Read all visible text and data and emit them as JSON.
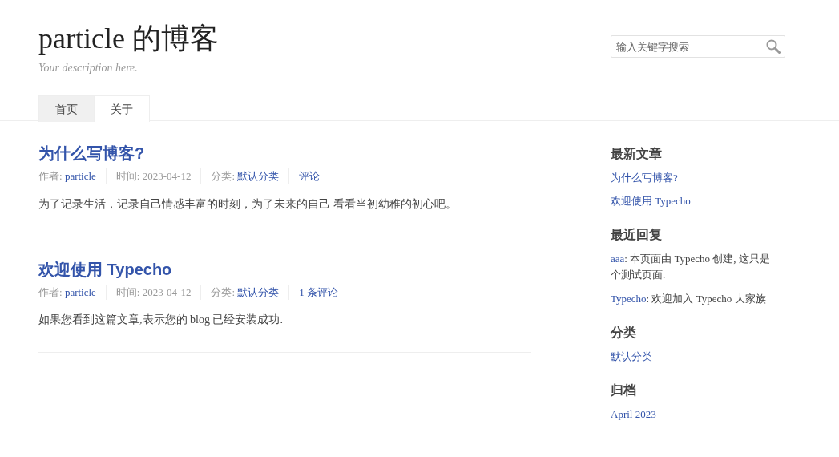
{
  "site": {
    "title": "particle 的博客",
    "description": "Your description here."
  },
  "search": {
    "placeholder": "输入关键字搜索"
  },
  "nav": [
    {
      "label": "首页",
      "selected": true
    },
    {
      "label": "关于",
      "selected": false
    }
  ],
  "posts": [
    {
      "title": "为什么写博客?",
      "author_label": "作者:",
      "author": "particle",
      "time_label": "时间:",
      "time": "2023-04-12",
      "category_label": "分类:",
      "category": "默认分类",
      "comments": "评论",
      "excerpt": "为了记录生活，记录自己情感丰富的时刻，为了未来的自己 看看当初幼稚的初心吧。"
    },
    {
      "title": "欢迎使用 Typecho",
      "author_label": "作者:",
      "author": "particle",
      "time_label": "时间:",
      "time": "2023-04-12",
      "category_label": "分类:",
      "category": "默认分类",
      "comments": "1 条评论",
      "excerpt": "如果您看到这篇文章,表示您的 blog 已经安装成功."
    }
  ],
  "sidebar": [
    {
      "kind": "links",
      "title": "最新文章",
      "items": [
        "为什么写博客?",
        "欢迎使用 Typecho"
      ]
    },
    {
      "kind": "replies",
      "title": "最近回复",
      "items": [
        {
          "author": "aaa",
          "text": ": 本页面由 Typecho 创建, 这只是个测试页面."
        },
        {
          "author": "Typecho",
          "text": ": 欢迎加入 Typecho 大家族"
        }
      ]
    },
    {
      "kind": "links",
      "title": "分类",
      "items": [
        "默认分类"
      ]
    },
    {
      "kind": "links",
      "title": "归档",
      "items": [
        "April 2023"
      ]
    }
  ]
}
